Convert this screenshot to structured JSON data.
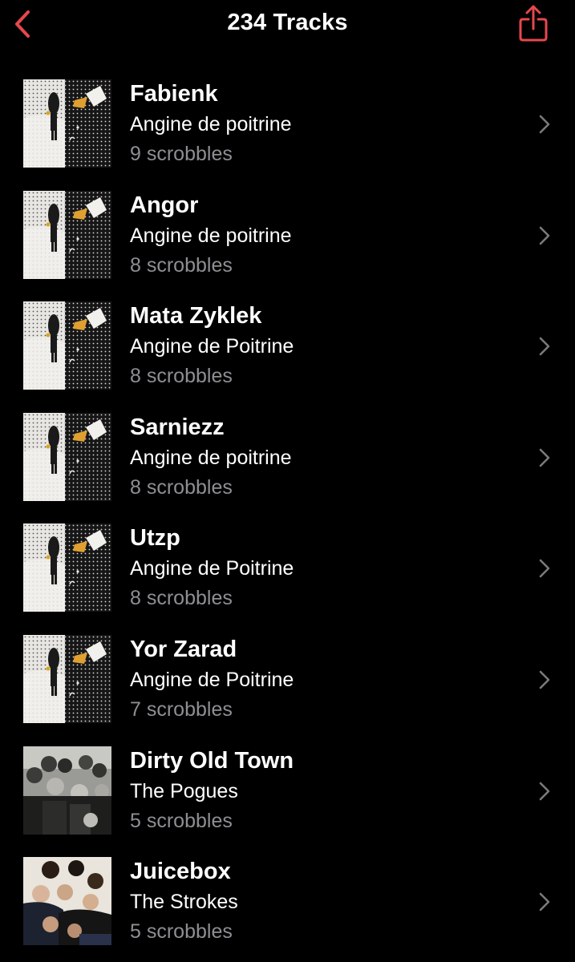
{
  "nav": {
    "title": "234 Tracks",
    "accent_color": "#e5484d",
    "back_icon": "chevron-left-icon",
    "share_icon": "share-icon"
  },
  "tracks": [
    {
      "title": "Fabienk",
      "artist": "Angine de poitrine",
      "scrobbles": "9 scrobbles",
      "artwork": "angine-cover"
    },
    {
      "title": "Angor",
      "artist": "Angine de poitrine",
      "scrobbles": "8 scrobbles",
      "artwork": "angine-cover"
    },
    {
      "title": "Mata Zyklek",
      "artist": "Angine de Poitrine",
      "scrobbles": "8 scrobbles",
      "artwork": "angine-cover"
    },
    {
      "title": "Sarniezz",
      "artist": "Angine de poitrine",
      "scrobbles": "8 scrobbles",
      "artwork": "angine-cover"
    },
    {
      "title": "Utzp",
      "artist": "Angine de Poitrine",
      "scrobbles": "8 scrobbles",
      "artwork": "angine-cover"
    },
    {
      "title": "Yor Zarad",
      "artist": "Angine de Poitrine",
      "scrobbles": "7 scrobbles",
      "artwork": "angine-cover"
    },
    {
      "title": "Dirty Old Town",
      "artist": "The Pogues",
      "scrobbles": "5 scrobbles",
      "artwork": "band-photo-bw"
    },
    {
      "title": "Juicebox",
      "artist": "The Strokes",
      "scrobbles": "5 scrobbles",
      "artwork": "band-photo-color"
    }
  ]
}
